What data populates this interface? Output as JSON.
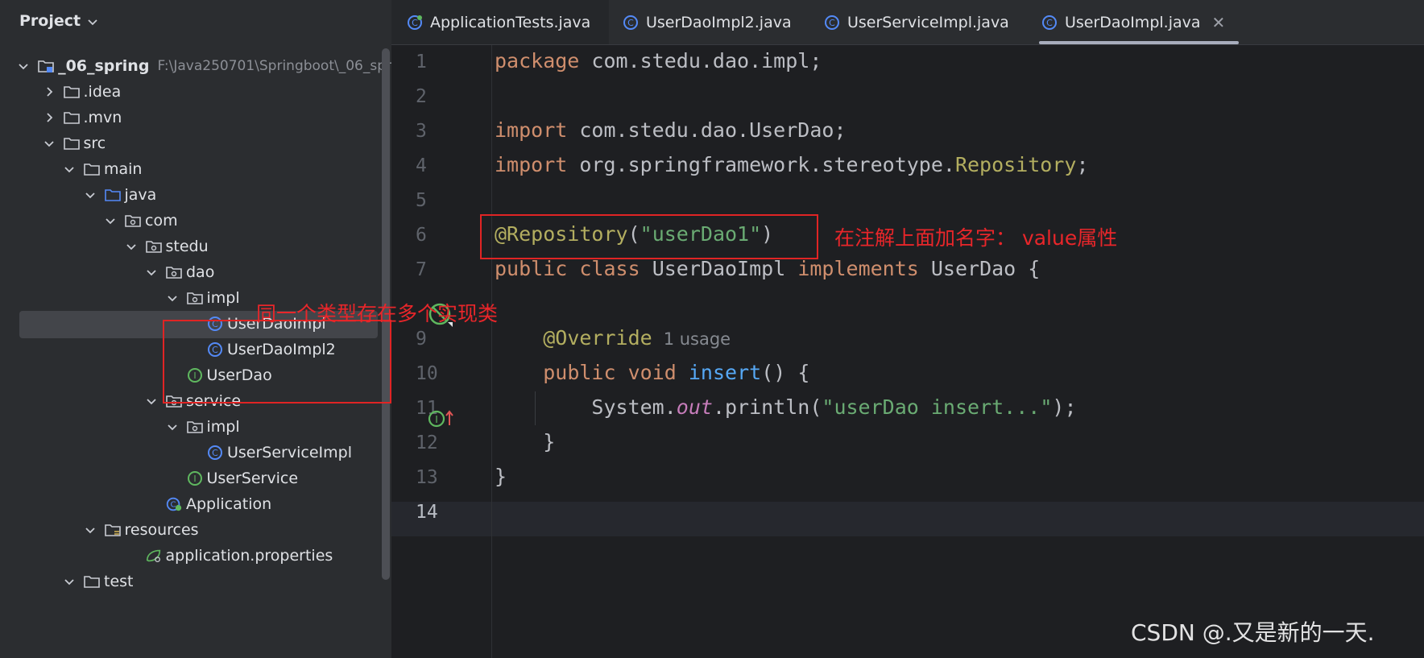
{
  "project_panel": {
    "title": "Project",
    "root_path": "F:\\Java250701\\Springboot\\_06_spr",
    "tree": [
      {
        "label": "_06_spring",
        "level": 0,
        "expanded": true,
        "icon": "module-folder-icon"
      },
      {
        "label": ".idea",
        "level": 1,
        "expanded": false,
        "icon": "folder-icon"
      },
      {
        "label": ".mvn",
        "level": 1,
        "expanded": false,
        "icon": "folder-icon"
      },
      {
        "label": "src",
        "level": 1,
        "expanded": true,
        "icon": "folder-icon"
      },
      {
        "label": "main",
        "level": 2,
        "expanded": true,
        "icon": "folder-icon"
      },
      {
        "label": "java",
        "level": 3,
        "expanded": true,
        "icon": "source-folder-icon"
      },
      {
        "label": "com",
        "level": 4,
        "expanded": true,
        "icon": "package-icon"
      },
      {
        "label": "stedu",
        "level": 5,
        "expanded": true,
        "icon": "package-icon"
      },
      {
        "label": "dao",
        "level": 6,
        "expanded": true,
        "icon": "package-icon"
      },
      {
        "label": "impl",
        "level": 7,
        "expanded": true,
        "icon": "package-icon"
      },
      {
        "label": "UserDaoImpl",
        "level": 8,
        "icon": "class-icon",
        "selected": true
      },
      {
        "label": "UserDaoImpl2",
        "level": 8,
        "icon": "class-icon"
      },
      {
        "label": "UserDao",
        "level": 7,
        "icon": "interface-icon"
      },
      {
        "label": "service",
        "level": 6,
        "expanded": true,
        "icon": "package-icon"
      },
      {
        "label": "impl",
        "level": 7,
        "expanded": true,
        "icon": "package-icon"
      },
      {
        "label": "UserServiceImpl",
        "level": 8,
        "icon": "class-icon"
      },
      {
        "label": "UserService",
        "level": 7,
        "icon": "interface-icon"
      },
      {
        "label": "Application",
        "level": 6,
        "icon": "spring-boot-class-icon"
      },
      {
        "label": "resources",
        "level": 3,
        "expanded": true,
        "icon": "resources-folder-icon"
      },
      {
        "label": "application.properties",
        "level": 5,
        "icon": "properties-file-icon"
      },
      {
        "label": "test",
        "level": 2,
        "expanded": true,
        "icon": "folder-icon"
      }
    ]
  },
  "tabs": [
    {
      "label": "ApplicationTests.java",
      "icon": "spring-test-class-icon"
    },
    {
      "label": "UserDaoImpl2.java",
      "icon": "class-icon"
    },
    {
      "label": "UserServiceImpl.java",
      "icon": "class-icon"
    },
    {
      "label": "UserDaoImpl.java",
      "icon": "class-icon",
      "active": true
    }
  ],
  "editor": {
    "line_numbers": [
      "1",
      "2",
      "3",
      "4",
      "5",
      "6",
      "7",
      "9",
      "10",
      "11",
      "12",
      "13",
      "14"
    ],
    "current_line": "14",
    "code": {
      "l1_kw": "package",
      "l1_rest": " com.stedu.dao.impl;",
      "l3_kw": "import",
      "l3_rest": " com.stedu.dao.UserDao;",
      "l4_kw": "import",
      "l4_rest": " org.springframework.stereotype.",
      "l4_cls": "Repository",
      "l4_end": ";",
      "l6_ann": "@Repository",
      "l6_open": "(",
      "l6_str": "\"userDao1\"",
      "l6_close": ")",
      "l7_kw1": "public",
      "l7_kw2": "class",
      "l7_name": " UserDaoImpl ",
      "l7_kw3": "implements",
      "l7_rest": " UserDao {",
      "l9_ann": "@Override",
      "l9_usage": "1 usage",
      "l10_kw1": "public",
      "l10_kw2": "void",
      "l10_fn": "insert",
      "l10_rest": "() {",
      "l11_a": "System.",
      "l11_static": "out",
      "l11_b": ".println(",
      "l11_str": "\"userDao insert...\"",
      "l11_c": ");",
      "l12": "}",
      "l13": "}"
    }
  },
  "annotations": {
    "note_repository": "在注解上面加名字： value属性",
    "note_multiple_impl": "同一个类型存在多个实现类",
    "color": "#e02424"
  },
  "watermark": "CSDN @.又是新的一天."
}
